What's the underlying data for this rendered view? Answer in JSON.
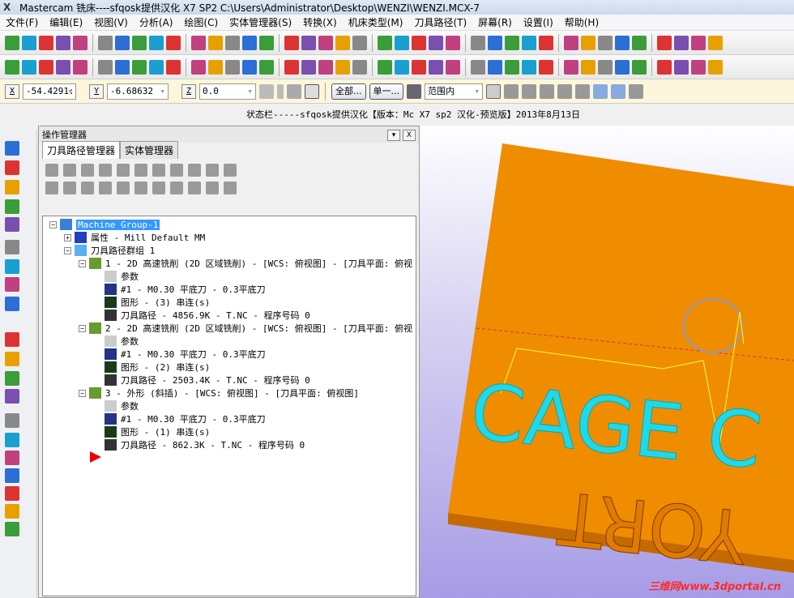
{
  "window": {
    "title": "Mastercam 铣床----sfqosk提供汉化 X7 SP2  C:\\Users\\Administrator\\Desktop\\WENZI\\WENZI.MCX-7"
  },
  "menu": [
    "文件(F)",
    "编辑(E)",
    "视图(V)",
    "分析(A)",
    "绘图(C)",
    "实体管理器(S)",
    "转换(X)",
    "机床类型(M)",
    "刀具路径(T)",
    "屏幕(R)",
    "设置(I)",
    "帮助(H)"
  ],
  "coords": {
    "x_label": "X",
    "x_value": "-54.4291:",
    "y_label": "Y",
    "y_value": "-6.68632",
    "z_label": "Z",
    "z_value": "0.0",
    "all_button": "全部...",
    "single_button": "单一...",
    "range_select": "范围内"
  },
  "status": "状态栏-----sfqosk提供汉化【版本：Mc X7 sp2 汉化-预览版】2013年8月13日",
  "manager": {
    "title": "操作管理器",
    "pin": "▾",
    "close": "X",
    "tabs": [
      "刀具路径管理器",
      "实体管理器"
    ]
  },
  "tree": {
    "root": "Machine Group-1",
    "properties": "属性 - Mill Default MM",
    "group": "刀具路径群组 1",
    "operations": [
      {
        "title": "1 - 2D 高速铣削 (2D 区域铣削) - [WCS: 俯视图] - [刀具平面: 俯视",
        "params": "参数",
        "tool": "#1 - M0.30 平底刀 - 0.3平底刀",
        "geometry": "图形 - (3) 串连(s)",
        "toolpath": "刀具路径 - 4856.9K - T.NC - 程序号码 0"
      },
      {
        "title": "2 - 2D 高速铣削 (2D 区域铣削) - [WCS: 俯视图] - [刀具平面: 俯视",
        "params": "参数",
        "tool": "#1 - M0.30 平底刀 - 0.3平底刀",
        "geometry": "图形 - (2) 串连(s)",
        "toolpath": "刀具路径 - 2503.4K - T.NC - 程序号码 0"
      },
      {
        "title": "3 - 外形 (斜插) - [WCS: 俯视图] - [刀具平面: 俯视图]",
        "params": "参数",
        "tool": "#1 - M0.30 平底刀 - 0.3平底刀",
        "geometry": "图形 - (1) 串连(s)",
        "toolpath": "刀具路径 - 862.3K - T.NC - 程序号码 0"
      }
    ]
  },
  "viewport": {
    "plate_color": "#f08c00",
    "text_color": "#22d8e8",
    "watermark": "三维网www.3dportal.cn"
  }
}
